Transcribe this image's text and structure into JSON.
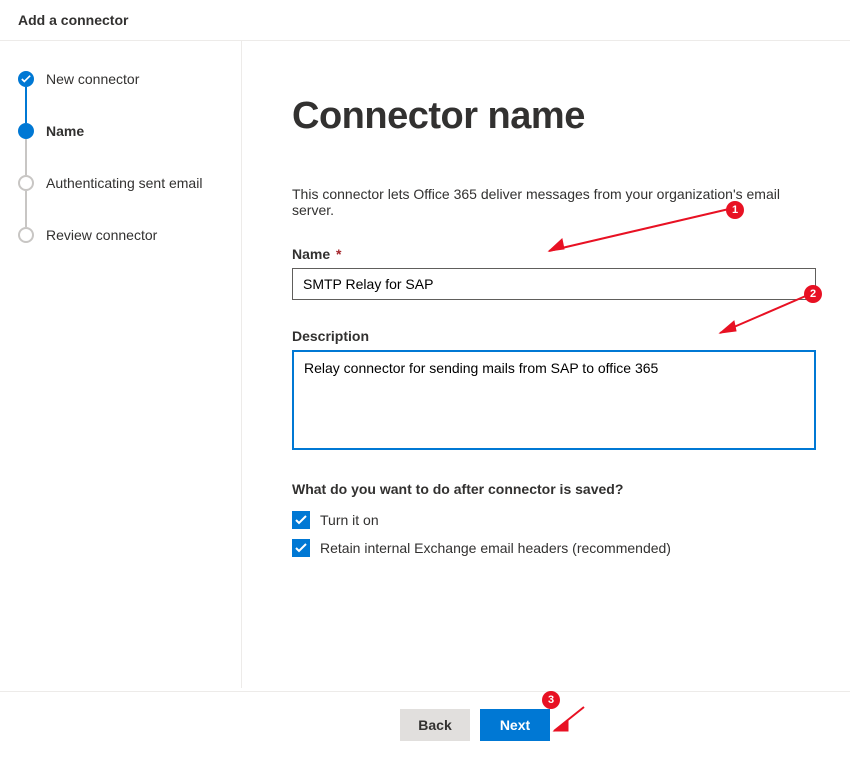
{
  "header": {
    "title": "Add a connector"
  },
  "stepper": {
    "steps": [
      {
        "label": "New connector",
        "state": "done"
      },
      {
        "label": "Name",
        "state": "current"
      },
      {
        "label": "Authenticating sent email",
        "state": "pending"
      },
      {
        "label": "Review connector",
        "state": "pending"
      }
    ]
  },
  "main": {
    "title": "Connector name",
    "intro": "This connector lets Office 365 deliver messages from your organization's email server.",
    "name_label": "Name",
    "name_required_marker": "*",
    "name_value": "SMTP Relay for SAP",
    "description_label": "Description",
    "description_value": "Relay connector for sending mails from SAP to office 365",
    "after_save_question": "What do you want to do after connector is saved?",
    "checkbox1_label": "Turn it on",
    "checkbox1_checked": true,
    "checkbox2_label": "Retain internal Exchange email headers (recommended)",
    "checkbox2_checked": true
  },
  "footer": {
    "back_label": "Back",
    "next_label": "Next"
  },
  "annotations": {
    "badge1": "1",
    "badge2": "2",
    "badge3": "3"
  }
}
